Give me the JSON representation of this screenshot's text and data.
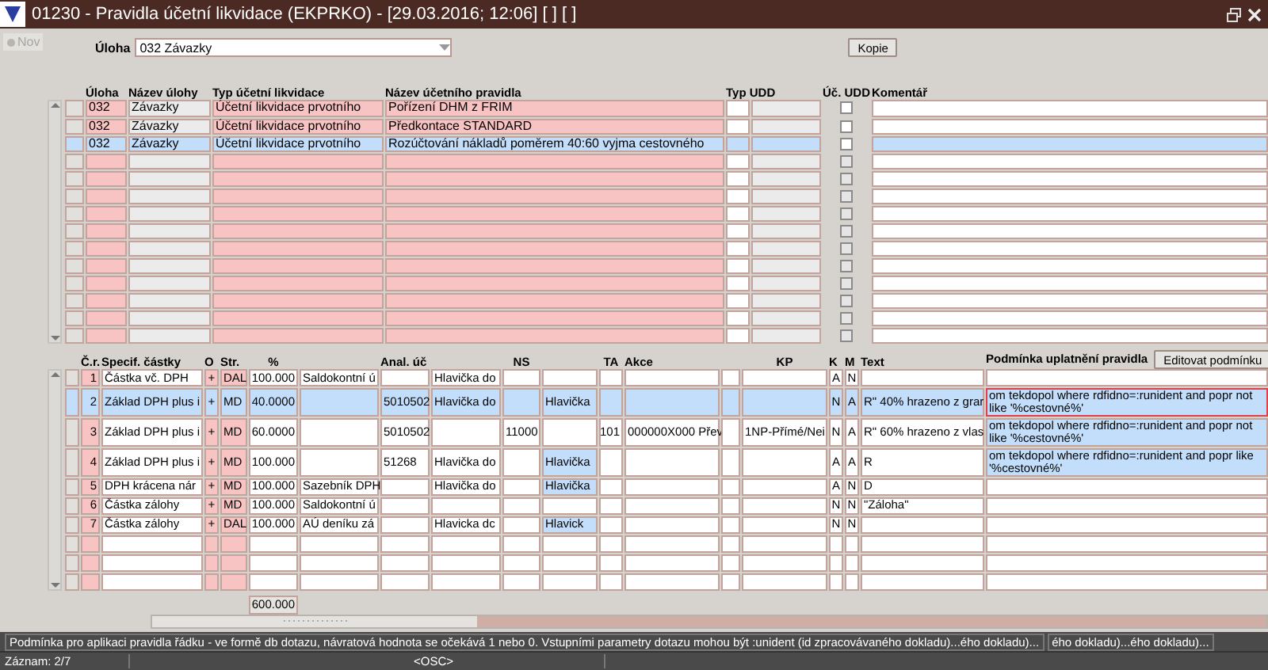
{
  "window": {
    "title": "01230 - Pravidla účetní likvidace (EKPRKO) - [29.03.2016; 12:06]  [ ]  [ ]"
  },
  "new_button": {
    "label": "Nov",
    "disabled": true
  },
  "task_field": {
    "label": "Úloha",
    "value": "032 Závazky"
  },
  "copy_button": {
    "label": "Kopie"
  },
  "rules_grid": {
    "headers": {
      "uloha": "Úloha",
      "nazev": "Název úlohy",
      "typ": "Typ účetní likvidace",
      "pravidlo": "Název účetního pravidla",
      "typudd": "Typ UDD",
      "chk": "Úč. UDD",
      "koment": "Komentář"
    },
    "rows": [
      {
        "uloha": "032",
        "nazev": "Závazky",
        "typ": "Účetní likvidace prvotního",
        "pravidlo": "Pořízení DHM z FRIM",
        "udd_checked": false,
        "selected": false
      },
      {
        "uloha": "032",
        "nazev": "Závazky",
        "typ": "Účetní likvidace prvotního",
        "pravidlo": "Předkontace STANDARD",
        "udd_checked": false,
        "selected": false
      },
      {
        "uloha": "032",
        "nazev": "Závazky",
        "typ": "Účetní likvidace prvotního",
        "pravidlo": "Rozúčtování nákladů poměrem 40:60 vyjma cestovného",
        "udd_checked": false,
        "selected": true
      }
    ],
    "empty_rows": [
      {
        "udd_checked": false
      },
      {
        "udd_checked": false
      },
      {
        "udd_checked": false
      },
      {
        "udd_checked": false
      },
      {
        "udd_checked": false
      },
      {
        "udd_checked": false
      },
      {
        "udd_checked": false
      },
      {
        "udd_checked": false
      },
      {
        "udd_checked": false
      },
      {
        "udd_checked": false
      },
      {
        "udd_checked": false
      }
    ]
  },
  "lines_grid": {
    "headers": {
      "nr": "Č.r.",
      "spec": "Specif. částky",
      "o": "O",
      "str": "Str.",
      "pct": "%",
      "anal": "Anal. úč",
      "ns": "NS",
      "ta": "TA",
      "akce": "Akce",
      "kp": "KP",
      "k": "K",
      "m": "M",
      "text": "Text",
      "cond": "Podmínka uplatnění pravidla"
    },
    "edit_button": {
      "label": "Editovat podmínku"
    },
    "rows": [
      {
        "nr": "1",
        "spec": "Částka vč. DPH",
        "o": "+",
        "str": "DAL",
        "pct": "100.000",
        "base": "Saldokontní ú",
        "hd": "Hlavička do",
        "k": "A",
        "m": "N",
        "selected": false,
        "focused": false
      },
      {
        "nr": "2",
        "spec": "Základ DPH plus i",
        "o": "+",
        "str": "MD",
        "pct": "40.0000",
        "anal": "5010502",
        "hd": "Hlavička do",
        "h2": "Hlavička",
        "k": "N",
        "m": "A",
        "text": "R\" 40% hrazeno z grar",
        "cond": "om tekdopol where  rdfidno=:runident and popr not like '%cestovné%'",
        "selected": true,
        "focused": true
      },
      {
        "nr": "3",
        "spec": "Základ DPH plus i",
        "o": "+",
        "str": "MD",
        "pct": "60.0000",
        "anal": "5010502",
        "ns": "11000",
        "ta": "101",
        "akce": "000000X000 Přev",
        "kp": "1NP-Přímé/Nei",
        "k": "N",
        "m": "A",
        "text": "R\" 60% hrazeno z vlas",
        "cond": "om tekdopol where  rdfidno=:runident and popr not like '%cestovné%'",
        "selected": false,
        "focused": false
      },
      {
        "nr": "4",
        "spec": "Základ DPH plus i",
        "o": "+",
        "str": "MD",
        "pct": "100.000",
        "anal": "51268",
        "hd": "Hlavička do",
        "h2": "Hlavička",
        "k": "A",
        "m": "A",
        "text": "R",
        "cond": "om tekdopol where  rdfidno=:runident and popr like '%cestovné%'",
        "selected": false,
        "focused": false
      },
      {
        "nr": "5",
        "spec": "DPH krácena nár",
        "o": "+",
        "str": "MD",
        "pct": "100.000",
        "base": "Sazebník DPH",
        "hd": "Hlavička do",
        "h2": "Hlavička",
        "k": "A",
        "m": "N",
        "text": "D",
        "selected": false,
        "focused": false
      },
      {
        "nr": "6",
        "spec": "Částka zálohy",
        "o": "+",
        "str": "MD",
        "pct": "100.000",
        "base": "Saldokontní ú",
        "k": "N",
        "m": "N",
        "text": "\"Záloha\"",
        "selected": false,
        "focused": false
      },
      {
        "nr": "7",
        "spec": "Částka zálohy",
        "o": "+",
        "str": "DAL",
        "pct": "100.000",
        "base": "AÚ deníku zá",
        "hd": "Hlavicka dc",
        "h2": "Hlavick",
        "k": "N",
        "m": "N",
        "selected": false,
        "focused": false
      }
    ],
    "total": "600.000"
  },
  "status_bar": {
    "hint": "Podmínka pro aplikaci pravidla řádku - ve formě db dotazu, návratová hodnota se očekává 1 nebo 0. Vstupními parametry dotazu mohou být :unident (id zpracovávaného dokladu)...ého dokladu)...",
    "hint_2": "ého dokladu)...ého dokladu)...",
    "record": "Záznam: 2/7",
    "mode": "<OSC>"
  }
}
